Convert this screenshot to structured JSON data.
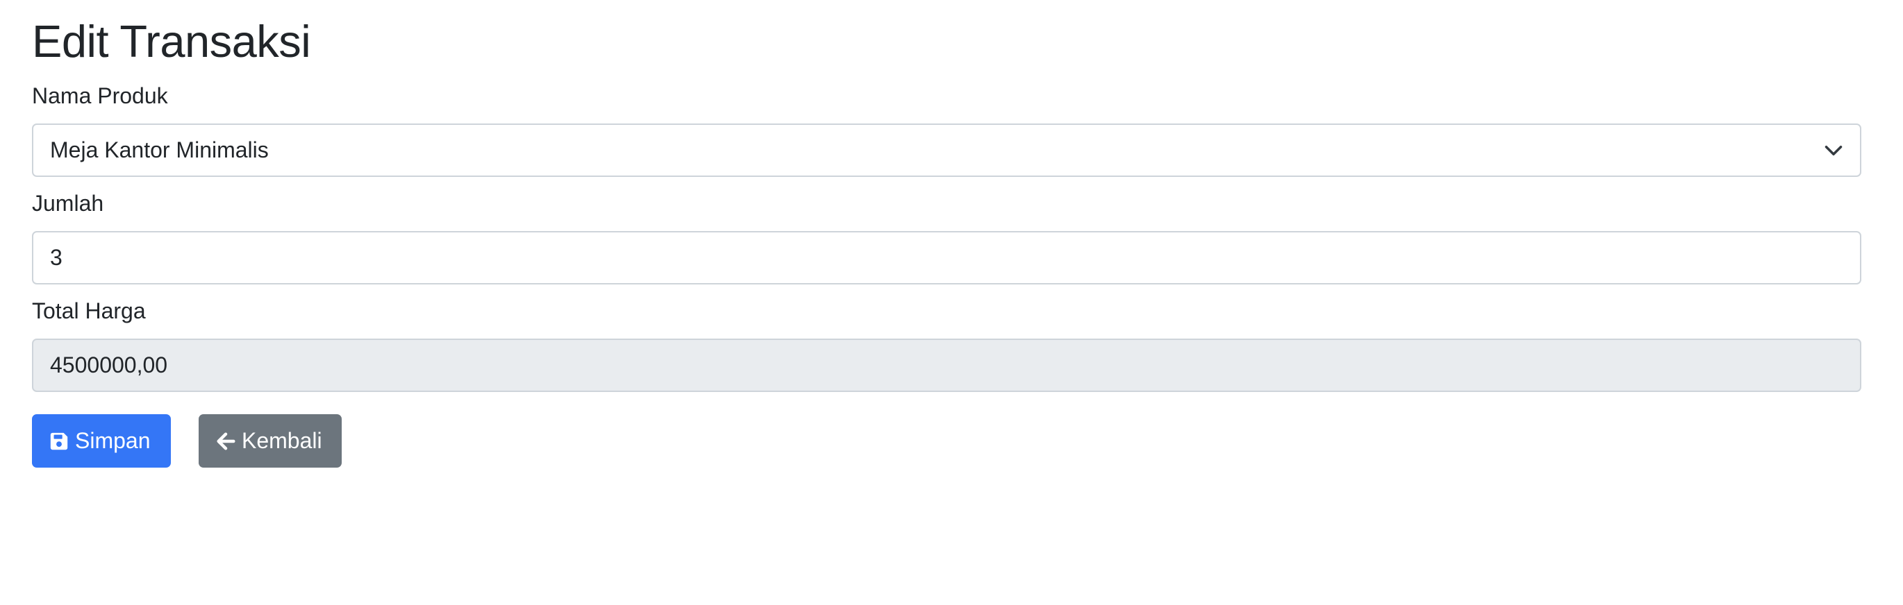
{
  "page": {
    "title": "Edit Transaksi"
  },
  "form": {
    "produk": {
      "label": "Nama Produk",
      "selected": "Meja Kantor Minimalis"
    },
    "jumlah": {
      "label": "Jumlah",
      "value": "3"
    },
    "total": {
      "label": "Total Harga",
      "value": "4500000,00"
    }
  },
  "buttons": {
    "save_label": "Simpan",
    "save_icon": "save-icon",
    "back_label": "Kembali",
    "back_icon": "arrow-left-icon"
  },
  "colors": {
    "primary": "#3476f6",
    "secondary": "#6c757d",
    "readonly_bg": "#e9ecef",
    "border": "#ced4da"
  }
}
